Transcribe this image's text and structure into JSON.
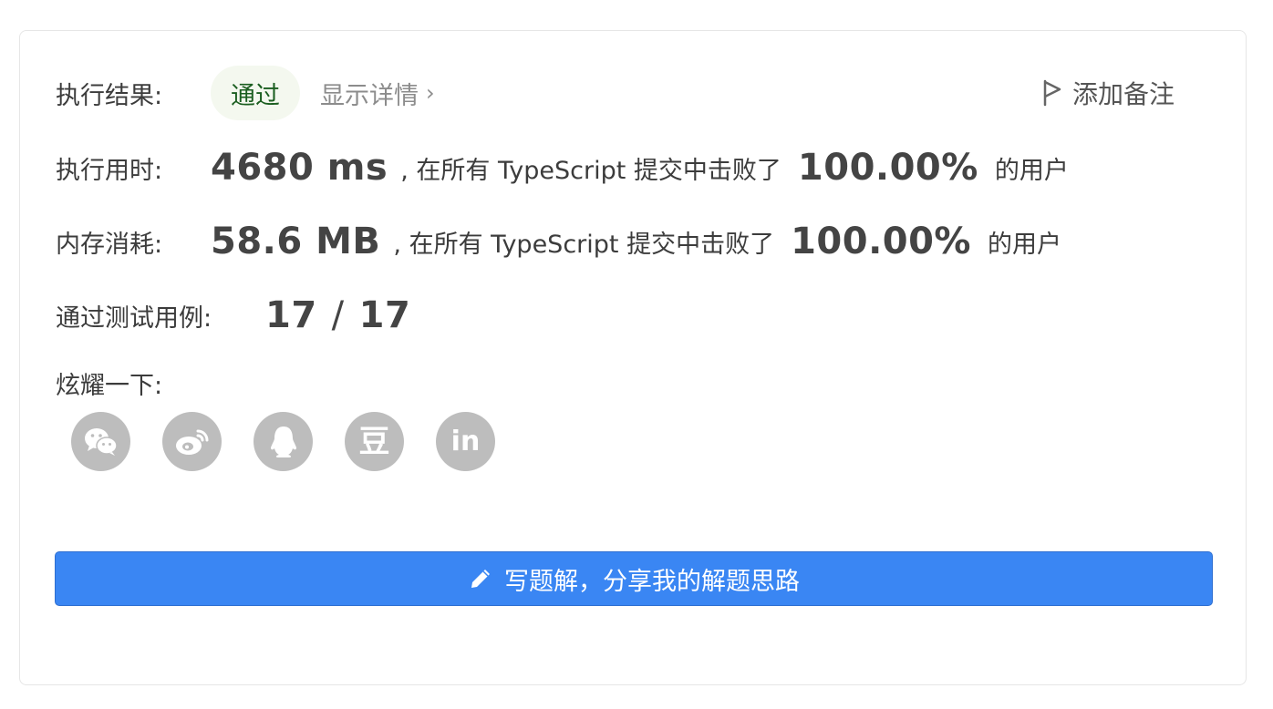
{
  "result": {
    "label": "执行结果:",
    "status": "通过",
    "details_link": "显示详情",
    "details_chevron": "›",
    "add_note": "添加备注"
  },
  "runtime": {
    "label": "执行用时:",
    "value": "4680 ms",
    "middle_text": ", 在所有 TypeScript 提交中击败了",
    "percent": "100.00%",
    "suffix": "的用户"
  },
  "memory": {
    "label": "内存消耗:",
    "value": "58.6 MB",
    "middle_text": ", 在所有 TypeScript 提交中击败了",
    "percent": "100.00%",
    "suffix": "的用户"
  },
  "testcases": {
    "label": "通过测试用例:",
    "passed": "17",
    "separator": "/",
    "total": "17"
  },
  "share": {
    "label": "炫耀一下:",
    "icons": [
      "wechat-icon",
      "weibo-icon",
      "qq-icon",
      "douban-icon",
      "linkedin-icon"
    ],
    "douban_glyph": "豆",
    "linkedin_glyph": "in"
  },
  "write_solution": {
    "label": "写题解，分享我的解题思路",
    "icon": "pencil-icon"
  },
  "colors": {
    "primary_button": "#3a86f3",
    "success_pill_bg": "#f4f8ef",
    "success_text": "#1b5e20",
    "social_icon_bg": "#bdbdbd"
  }
}
